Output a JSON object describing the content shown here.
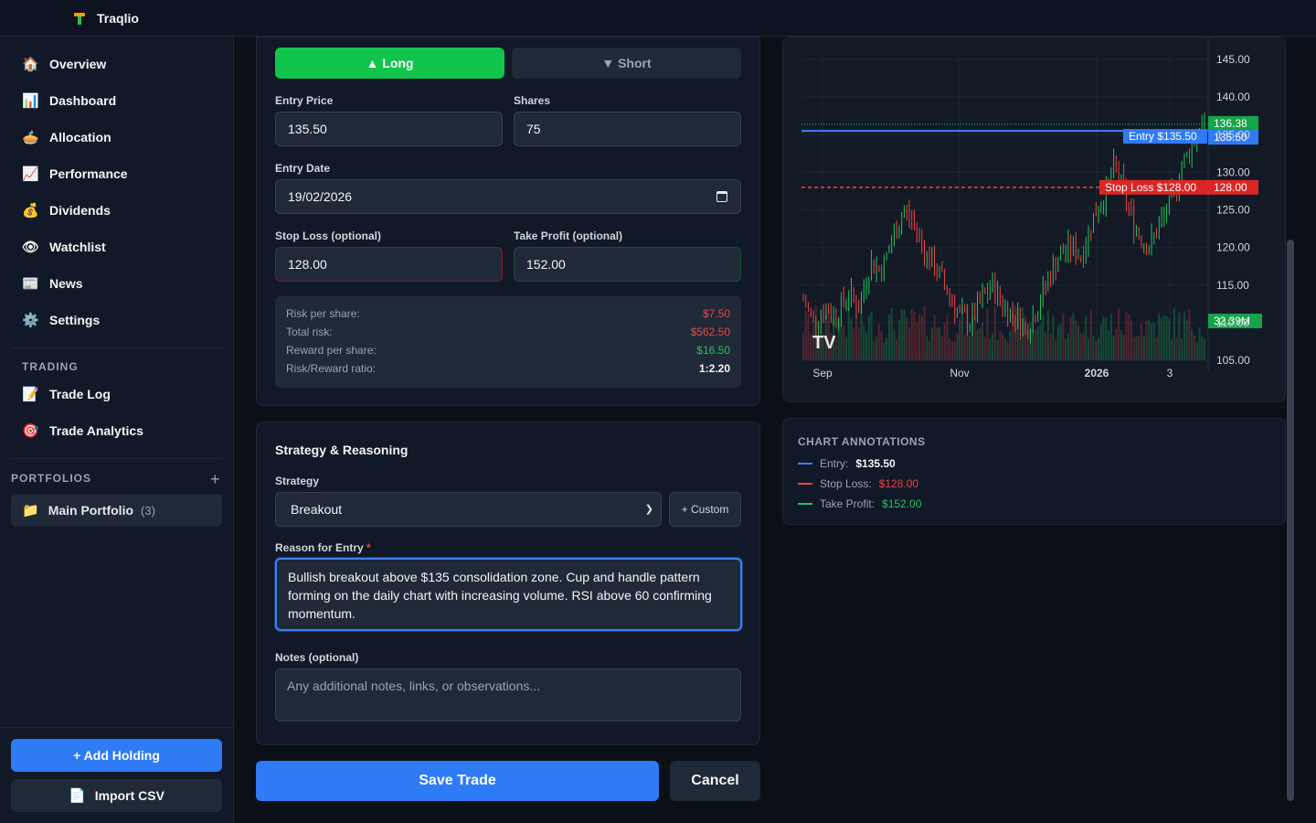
{
  "app": {
    "name": "Traqlio"
  },
  "sidebar": {
    "items": [
      {
        "icon": "house-icon",
        "glyph": "🏠",
        "label": "Overview"
      },
      {
        "icon": "bar-chart-icon",
        "glyph": "📊",
        "label": "Dashboard"
      },
      {
        "icon": "pie-icon",
        "glyph": "🥧",
        "label": "Allocation"
      },
      {
        "icon": "chart-up-icon",
        "glyph": "📈",
        "label": "Performance"
      },
      {
        "icon": "money-bag-icon",
        "glyph": "💰",
        "label": "Dividends"
      },
      {
        "icon": "eye-icon",
        "glyph": "👁",
        "label": "Watchlist"
      },
      {
        "icon": "newspaper-icon",
        "glyph": "📰",
        "label": "News"
      },
      {
        "icon": "gear-icon",
        "glyph": "⚙️",
        "label": "Settings"
      }
    ],
    "trading_title": "TRADING",
    "trading_items": [
      {
        "icon": "memo-icon",
        "glyph": "📝",
        "label": "Trade Log"
      },
      {
        "icon": "target-icon",
        "glyph": "🎯",
        "label": "Trade Analytics"
      }
    ],
    "portfolios_title": "PORTFOLIOS",
    "portfolio": {
      "icon": "folder-icon",
      "glyph": "📁",
      "label": "Main Portfolio",
      "count": "(3)"
    },
    "add_holding": "+ Add Holding",
    "import_csv": "Import CSV"
  },
  "form": {
    "long_label": "▲ Long",
    "short_label": "▼ Short",
    "entry_price_label": "Entry Price",
    "entry_price": "135.50",
    "shares_label": "Shares",
    "shares": "75",
    "entry_date_label": "Entry Date",
    "entry_date": "19/02/2026",
    "stop_loss_label": "Stop Loss (optional)",
    "stop_loss": "128.00",
    "take_profit_label": "Take Profit (optional)",
    "take_profit": "152.00",
    "summary": [
      {
        "label": "Risk per share:",
        "value": "$7.50",
        "color": "#ef4444"
      },
      {
        "label": "Total risk:",
        "value": "$562.50",
        "color": "#ef4444"
      },
      {
        "label": "Reward per share:",
        "value": "$16.50",
        "color": "#22c55e"
      },
      {
        "label": "Risk/Reward ratio:",
        "value": "1:2.20",
        "color": "#f3f4f6"
      }
    ]
  },
  "strategy": {
    "title": "Strategy & Reasoning",
    "strategy_label": "Strategy",
    "strategy_value": "Breakout",
    "custom_button": "+ Custom",
    "reason_label": "Reason for Entry",
    "required_mark": "*",
    "reason_text": "Bullish breakout above $135 consolidation zone. Cup and handle pattern forming on the daily chart with increasing volume. RSI above 60 confirming momentum.",
    "notes_label": "Notes (optional)",
    "notes_placeholder": "Any additional notes, links, or observations..."
  },
  "actions": {
    "save": "Save Trade",
    "cancel": "Cancel"
  },
  "chart": {
    "price_ticks": [
      "145.00",
      "140.00",
      "135.00",
      "130.00",
      "125.00",
      "120.00",
      "115.00",
      "110.00",
      "105.00"
    ],
    "x_ticks": [
      "Sep",
      "Nov",
      "2026",
      "3"
    ],
    "last_price": "136.38",
    "entry_tag": "Entry $135.50",
    "entry_value": "135.50",
    "stop_tag": "Stop Loss $128.00",
    "stop_value": "128.00",
    "volume": "32.39M",
    "watermark": "TV"
  },
  "chart_data": {
    "type": "candlestick",
    "x_labels": [
      "Sep",
      "Nov",
      "2026",
      "3"
    ],
    "ylim": [
      105,
      145
    ],
    "y_ticks": [
      145,
      140,
      135,
      130,
      125,
      120,
      115,
      110,
      105
    ],
    "close_path": [
      113,
      110,
      112,
      111,
      114,
      112,
      118,
      117,
      121,
      125,
      123,
      119,
      117,
      114,
      111,
      110,
      113,
      115,
      112,
      111,
      109,
      112,
      116,
      119,
      120,
      119,
      124,
      127,
      131,
      126,
      122,
      120,
      123,
      126,
      131,
      134,
      136.38
    ],
    "lines": {
      "entry": 135.5,
      "stop_loss": 128.0,
      "last": 136.38
    },
    "last_volume": "32.39M"
  },
  "annotations": {
    "title": "CHART ANNOTATIONS",
    "rows": [
      {
        "label": "Entry:",
        "value": "$135.50",
        "line_color": "#3b82f6",
        "value_color": "#f3f4f6"
      },
      {
        "label": "Stop Loss:",
        "value": "$128.00",
        "line_color": "#ef4444",
        "value_color": "#ef4444"
      },
      {
        "label": "Take Profit:",
        "value": "$152.00",
        "line_color": "#22c55e",
        "value_color": "#22c55e"
      }
    ]
  }
}
